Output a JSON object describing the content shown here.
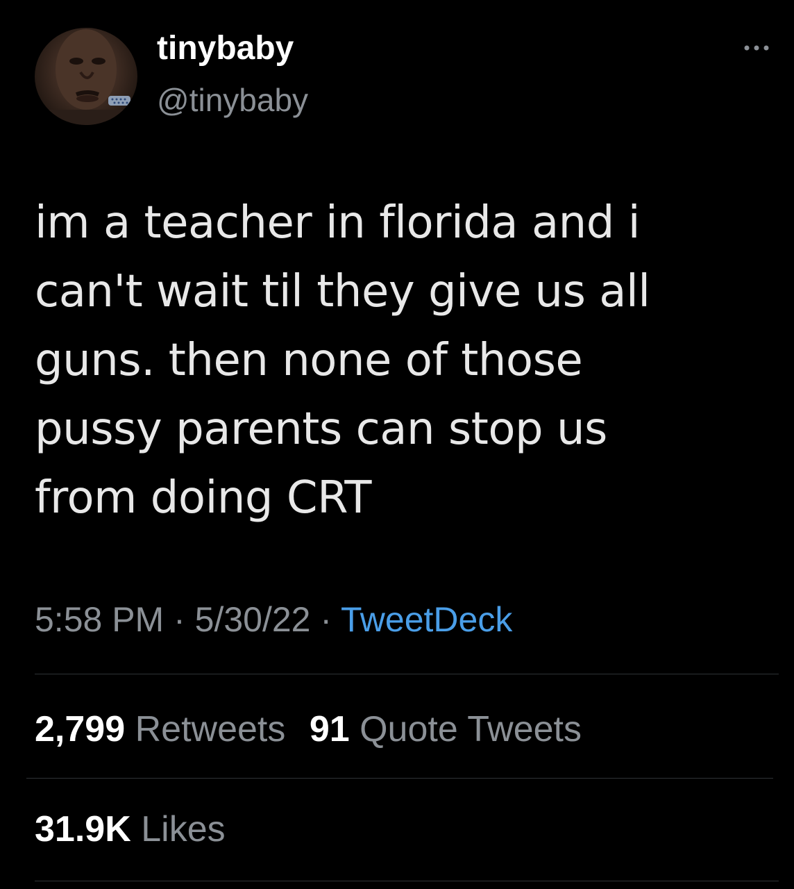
{
  "author": {
    "display_name": "tinybaby",
    "handle": "@tinybaby",
    "avatar_icon": "profile-photo"
  },
  "tweet": {
    "text_lines": [
      "im a teacher in florida and i",
      "can't wait til they give us all",
      "guns. then none of those",
      "pussy parents can stop us",
      "from doing CRT"
    ],
    "time": "5:58 PM",
    "separator1": " · ",
    "date": "5/30/22",
    "separator2": " · ",
    "source": "TweetDeck"
  },
  "stats": {
    "retweets_count": "2,799",
    "retweets_label": "Retweets",
    "quotes_count": "91",
    "quotes_label": "Quote Tweets",
    "likes_count": "31.9K",
    "likes_label": "Likes"
  },
  "colors": {
    "background": "#000000",
    "text": "#e7e9ea",
    "secondary": "#8b9096",
    "link": "#4a9ee8",
    "divider": "#2f3336"
  }
}
